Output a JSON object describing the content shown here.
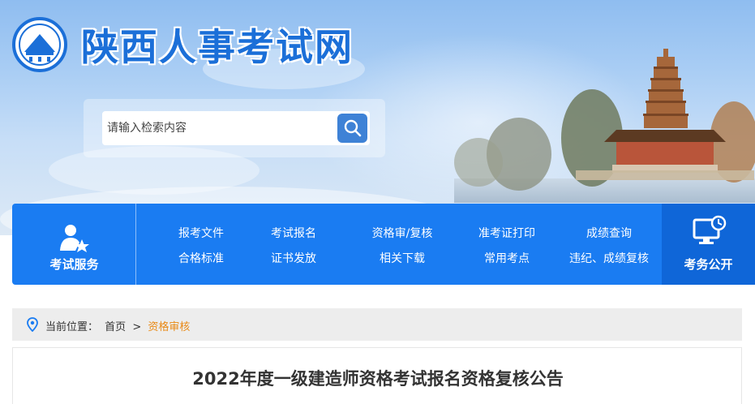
{
  "header": {
    "site_title": "陕西人事考试网",
    "search": {
      "placeholder": "请输入检索内容",
      "value": ""
    }
  },
  "nav": {
    "left": {
      "label": "考试服务",
      "icon": "user-star-icon"
    },
    "links_row1": [
      "报考文件",
      "考试报名",
      "资格审/复核",
      "准考证打印",
      "成绩查询"
    ],
    "links_row2": [
      "合格标准",
      "证书发放",
      "相关下载",
      "常用考点",
      "违纪、成绩复核"
    ],
    "right": {
      "label": "考务公开",
      "icon": "monitor-clock-icon"
    }
  },
  "breadcrumb": {
    "prefix": "当前位置：",
    "home": "首页",
    "separator": ">",
    "current": "资格审核"
  },
  "article": {
    "title": "2022年度一级建造师资格考试报名资格复核公告"
  },
  "colors": {
    "brand_blue": "#1a7cf2",
    "breadcrumb_current": "#e98a17"
  }
}
